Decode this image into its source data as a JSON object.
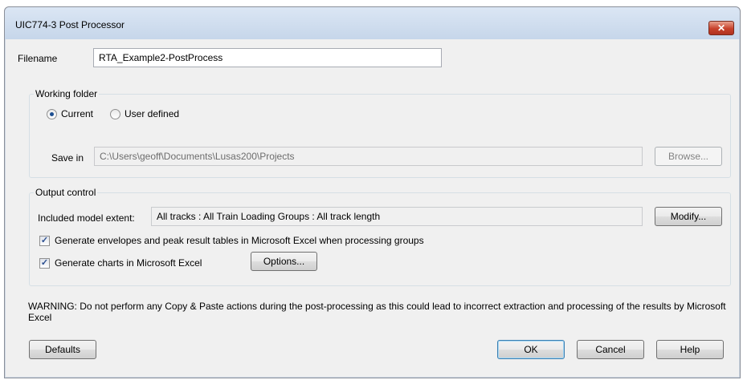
{
  "window": {
    "title": "UIC774-3 Post Processor",
    "close_label": "✕"
  },
  "filename": {
    "label": "Filename",
    "value": "RTA_Example2-PostProcess"
  },
  "working_folder": {
    "legend": "Working folder",
    "current_label": "Current",
    "user_defined_label": "User defined",
    "selected": "Current",
    "save_in_label": "Save in",
    "save_in_value": "C:\\Users\\geoff\\Documents\\Lusas200\\Projects",
    "browse_label": "Browse..."
  },
  "output_control": {
    "legend": "Output control",
    "extent_label": "Included model extent:",
    "extent_value": "All tracks : All Train Loading Groups : All track length",
    "modify_label": "Modify...",
    "envelopes_label": "Generate envelopes and peak result tables in Microsoft Excel when processing groups",
    "envelopes_checked": true,
    "charts_label": "Generate charts in Microsoft Excel",
    "charts_checked": true,
    "options_label": "Options..."
  },
  "warning": "WARNING: Do not perform any Copy & Paste actions during the post-processing as this could lead to incorrect extraction and processing of the results by Microsoft Excel",
  "buttons": {
    "defaults": "Defaults",
    "ok": "OK",
    "cancel": "Cancel",
    "help": "Help"
  }
}
